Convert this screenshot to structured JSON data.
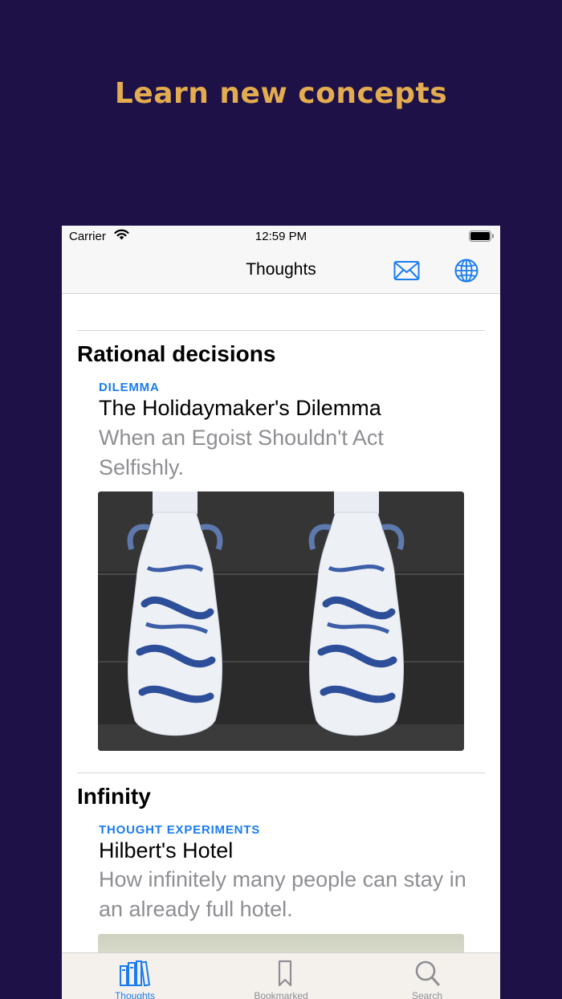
{
  "promo": {
    "title": "Learn new concepts"
  },
  "status_bar": {
    "carrier": "Carrier",
    "time": "12:59 PM"
  },
  "nav": {
    "title": "Thoughts",
    "mail_icon": "mail-icon",
    "globe_icon": "globe-icon"
  },
  "sections": [
    {
      "title": "Rational decisions",
      "item": {
        "category": "DILEMMA",
        "title": "The Holidaymaker's Dilemma",
        "subtitle": "When an Egoist Shouldn't Act Selfishly."
      }
    },
    {
      "title": "Infinity",
      "item": {
        "category": "THOUGHT EXPERIMENTS",
        "title": "Hilbert's Hotel",
        "subtitle": "How infinitely many people can stay in an already full hotel."
      }
    }
  ],
  "tabs": [
    {
      "label": "Thoughts",
      "icon": "books-icon",
      "active": true
    },
    {
      "label": "Bookmarked",
      "icon": "bookmark-icon",
      "active": false
    },
    {
      "label": "Search",
      "icon": "search-icon",
      "active": false
    }
  ],
  "colors": {
    "background": "#1e1147",
    "promo_title": "#e2ac4f",
    "accent": "#1b7cf0",
    "secondary_text": "#8e8e93"
  }
}
